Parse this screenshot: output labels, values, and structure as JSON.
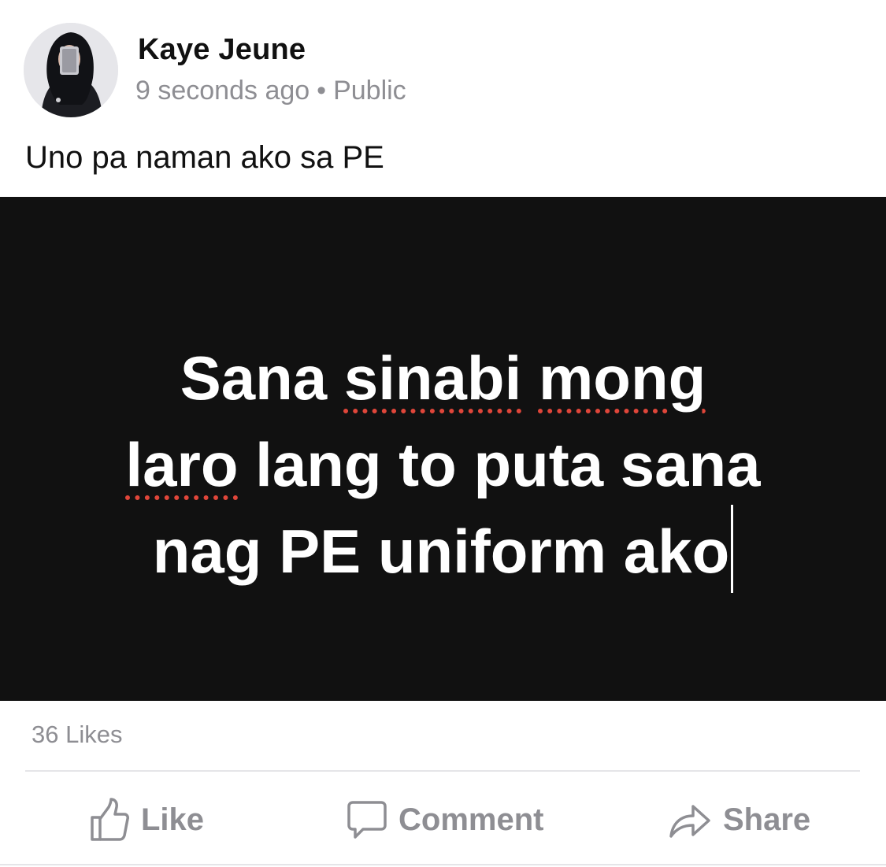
{
  "post": {
    "author": "Kaye Jeune",
    "time": "9 seconds ago",
    "separator": "•",
    "visibility": "Public",
    "caption": "Uno pa naman ako sa PE",
    "photo_text": {
      "line1_a": "Sana ",
      "line1_b": "sinabi",
      "line1_c": " ",
      "line1_d": "mong",
      "line2_a": "laro",
      "line2_b": " lang to puta sana",
      "line3": "nag PE uniform ako"
    },
    "likes": "36 Likes"
  },
  "actions": {
    "like": "Like",
    "comment": "Comment",
    "share": "Share"
  },
  "colors": {
    "photo_background": "#111111",
    "spellcheck_underline": "#e0463a",
    "muted_text": "#8e8e93"
  }
}
